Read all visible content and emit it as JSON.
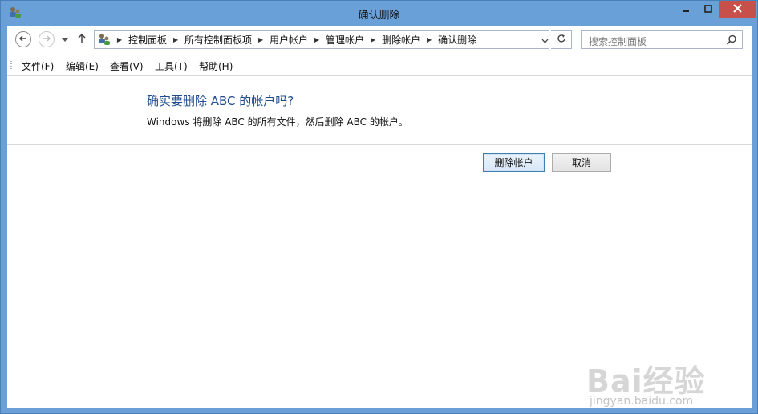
{
  "window": {
    "title": "确认删除",
    "app_icon": "user-accounts-icon",
    "controls": {
      "minimize": "minimize-icon",
      "maximize": "maximize-icon",
      "close": "close-icon"
    }
  },
  "navigation": {
    "back_icon": "back-arrow-icon",
    "forward_icon": "forward-arrow-icon",
    "recent_icon": "chevron-down-icon",
    "up_icon": "up-arrow-icon",
    "breadcrumbs": [
      "控制面板",
      "所有控制面板项",
      "用户帐户",
      "管理帐户",
      "删除帐户",
      "确认删除"
    ],
    "search_placeholder": "搜索控制面板"
  },
  "menu": {
    "items": [
      "文件(F)",
      "编辑(E)",
      "查看(V)",
      "工具(T)",
      "帮助(H)"
    ]
  },
  "content": {
    "heading": "确实要删除 ABC 的帐户吗?",
    "description": "Windows 将删除 ABC 的所有文件，然后删除 ABC 的帐户。"
  },
  "buttons": {
    "delete_label": "删除帐户",
    "cancel_label": "取消"
  },
  "watermark": {
    "logo_text": "Bai经验",
    "sub_text": "jingyan.baidu.com"
  },
  "colors": {
    "frame": "#6aa0d8",
    "close": "#c7504a",
    "heading": "#1e4b8f"
  }
}
